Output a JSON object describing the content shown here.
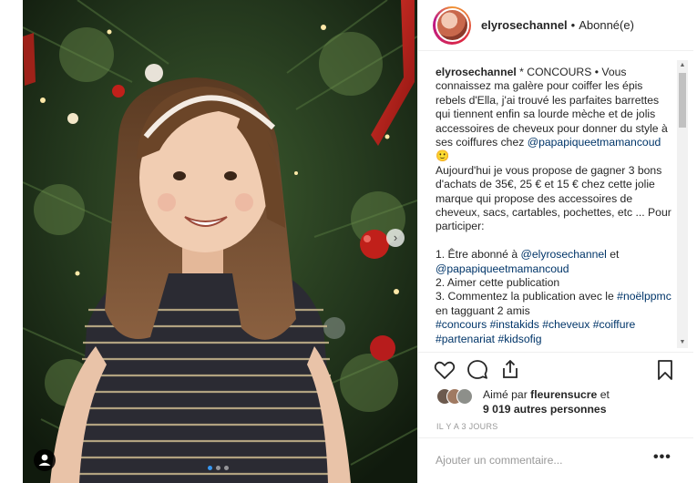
{
  "post": {
    "username": "elyrosechannel",
    "separator": "•",
    "follow_status": "Abonné(e)"
  },
  "caption": {
    "username": "elyrosechannel",
    "p1": "* CONCOURS • Vous connaissez ma galère pour coiffer les épis rebels d'Ella, j'ai trouvé les parfaites barrettes qui tiennent enfin sa lourde mèche et de jolis accessoires de cheveux pour donner du style à ses coiffures chez",
    "mention_brand": "@papapiqueetmamancoud",
    "emoji": "🙂",
    "p2": "Aujourd'hui je vous propose de gagner 3 bons d'achats de 35€, 25 € et 15 € chez cette jolie marque qui propose des accessoires de cheveux, sacs, cartables, pochettes, etc ... Pour participer:",
    "step1_prefix": "1. Être abonné à",
    "step1_mention1": "@elyrosechannel",
    "step1_and": "et",
    "step1_mention2": "@papapiqueetmamancoud",
    "step2": "2. Aimer cette publication",
    "step3_prefix": "3. Commentez la publication avec le",
    "step3_hashtag": "#noëlppmc",
    "step3_suffix": "en tagguant 2 amis",
    "hashtags": [
      "#concours",
      "#instakids",
      "#cheveux",
      "#coiffure",
      "#partenariat",
      "#kidsofig"
    ]
  },
  "likes": {
    "prefix": "Aimé par",
    "user": "fleurensucre",
    "connector": "et",
    "others": "9 019 autres personnes"
  },
  "timestamp": "IL Y A 3 JOURS",
  "comment": {
    "placeholder": "Ajouter un commentaire...",
    "more": "•••"
  },
  "carousel": {
    "slides": 3,
    "active": 1,
    "next_arrow": "›"
  },
  "icons": {
    "like": "heart-icon",
    "comment": "comment-bubble-icon",
    "share": "share-icon",
    "save": "bookmark-icon",
    "tags": "user-tag-icon"
  },
  "colors": {
    "link": "#003569",
    "text": "#262626",
    "muted": "#999999",
    "active_dot": "#3897f0"
  }
}
